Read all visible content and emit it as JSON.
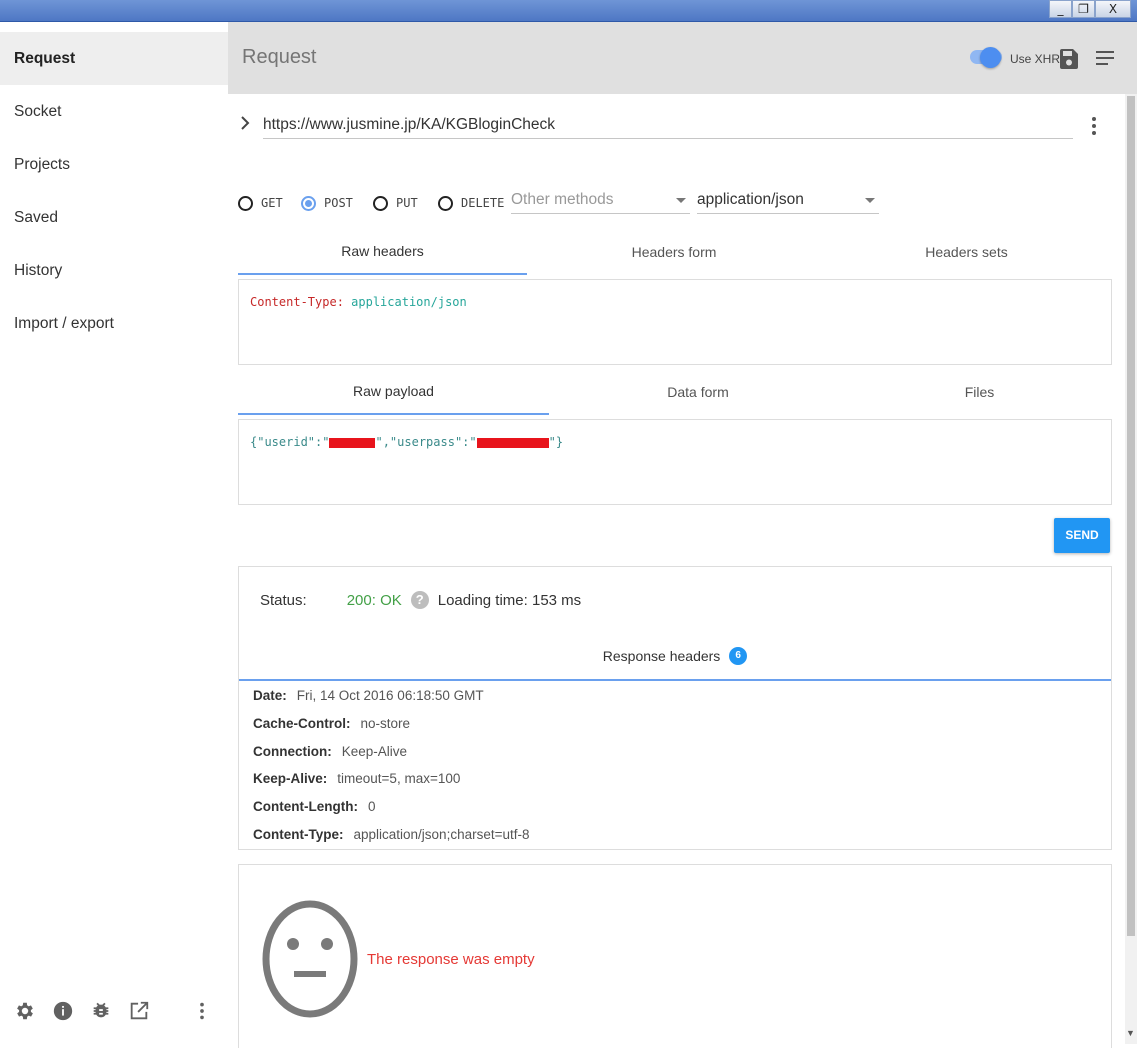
{
  "window": {
    "minimize": "_",
    "restore": "❐",
    "close": "X"
  },
  "sidebar": {
    "items": [
      {
        "label": "Request",
        "active": true
      },
      {
        "label": "Socket"
      },
      {
        "label": "Projects"
      },
      {
        "label": "Saved"
      },
      {
        "label": "History"
      },
      {
        "label": "Import / export"
      }
    ],
    "footer_icons": [
      "gear-icon",
      "info-icon",
      "bug-icon",
      "open-external-icon",
      "more-vert-icon"
    ]
  },
  "header": {
    "title": "Request",
    "xhr_label": "Use XHR",
    "xhr_enabled": true
  },
  "request": {
    "url": "https://www.jusmine.jp/KA/KGBloginCheck",
    "methods": [
      "GET",
      "POST",
      "PUT",
      "DELETE"
    ],
    "selected_method": "POST",
    "other_methods_placeholder": "Other methods",
    "content_type": "application/json"
  },
  "headers_tabs": [
    "Raw headers",
    "Headers form",
    "Headers sets"
  ],
  "raw_headers": {
    "key": "Content-Type:",
    "value": "application/json"
  },
  "payload_tabs": [
    "Raw payload",
    "Data form",
    "Files"
  ],
  "raw_payload": {
    "open": "{\"userid\":\"",
    "mid": "\",\"userpass\":\"",
    "close": "\"}"
  },
  "send_label": "SEND",
  "response": {
    "status_label": "Status:",
    "status_value": "200: OK",
    "help": "?",
    "loading_time": "Loading time: 153 ms",
    "headers_tab": "Response headers",
    "headers_count": "6",
    "headers": [
      {
        "key": "Date:",
        "value": "Fri, 14 Oct 2016 06:18:50 GMT"
      },
      {
        "key": "Cache-Control:",
        "value": "no-store"
      },
      {
        "key": "Connection:",
        "value": "Keep-Alive"
      },
      {
        "key": "Keep-Alive:",
        "value": "timeout=5, max=100"
      },
      {
        "key": "Content-Length:",
        "value": "0"
      },
      {
        "key": "Content-Type:",
        "value": "application/json;charset=utf-8"
      }
    ],
    "empty_message": "The response was empty"
  },
  "colors": {
    "accent": "#2196f3",
    "status_ok": "#43a047",
    "error": "#e53935",
    "header_bg": "#e0e0e0"
  }
}
